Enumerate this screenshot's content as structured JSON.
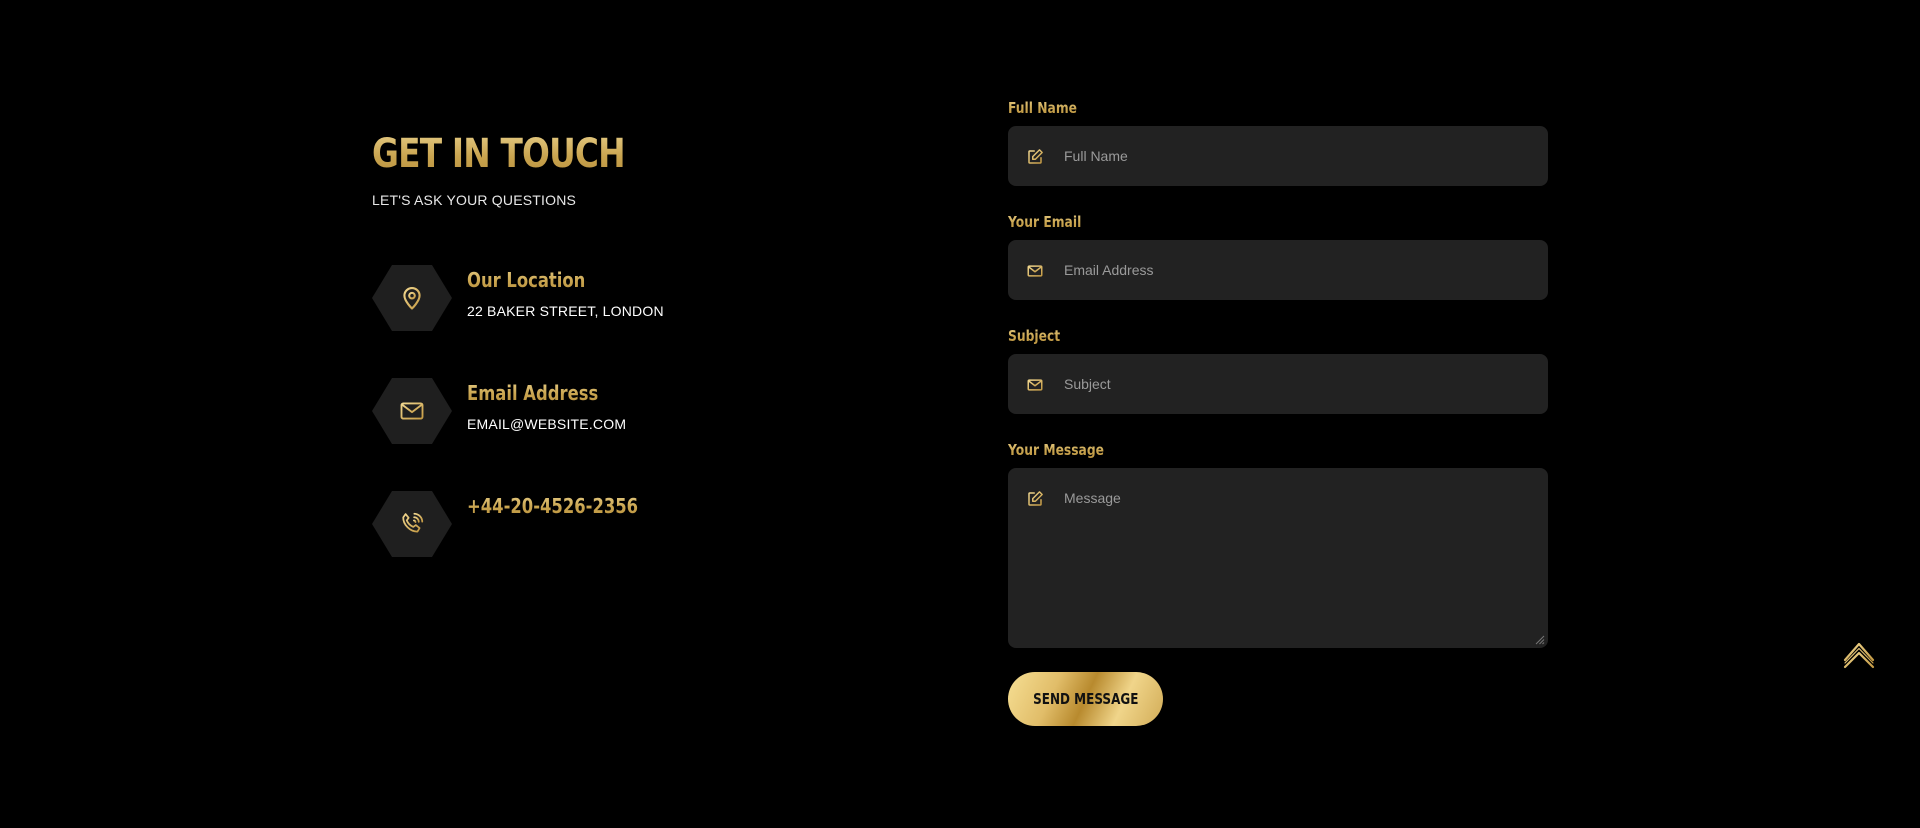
{
  "contact": {
    "title": "GET IN TOUCH",
    "subtitle": "LET'S ASK YOUR QUESTIONS",
    "location": {
      "heading": "Our Location",
      "value": "22 BAKER STREET, LONDON",
      "icon": "map-pin-icon"
    },
    "email": {
      "heading": "Email Address",
      "value": "EMAIL@WEBSITE.COM",
      "icon": "envelope-icon"
    },
    "phone": {
      "heading": "+44-20-4526-2356",
      "icon": "phone-icon"
    }
  },
  "form": {
    "full_name": {
      "label": "Full Name",
      "placeholder": "Full Name",
      "value": "",
      "icon": "edit-icon"
    },
    "email": {
      "label": "Your Email",
      "placeholder": "Email Address",
      "value": "",
      "icon": "envelope-icon"
    },
    "subject": {
      "label": "Subject",
      "placeholder": "Subject",
      "value": "",
      "icon": "envelope-icon"
    },
    "message": {
      "label": "Your Message",
      "placeholder": "Message",
      "value": "",
      "icon": "edit-icon"
    },
    "submit_label": "SEND MESSAGE"
  },
  "scroll_top_icon": "double-chevron-up-icon",
  "colors": {
    "background": "#000000",
    "gold_light": "#e8cf8a",
    "gold_dark": "#b8903c",
    "panel": "#222222",
    "hex_bg": "#1f1f1f"
  }
}
